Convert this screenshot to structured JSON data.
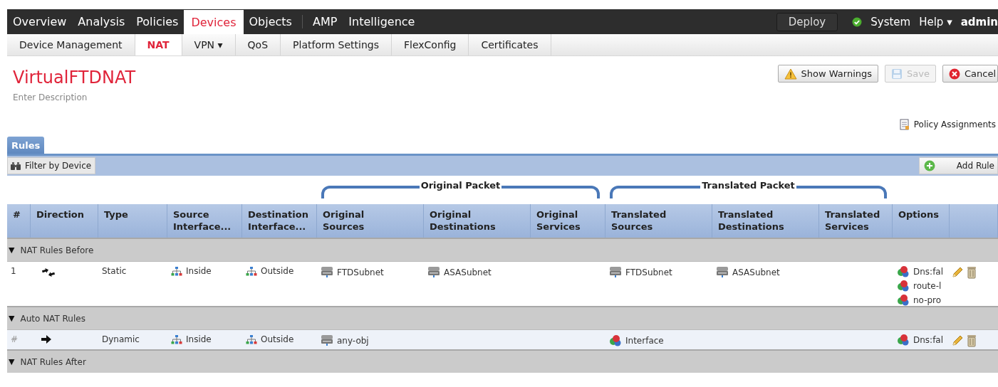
{
  "top_nav": {
    "items": [
      {
        "label": "Overview",
        "selected": false
      },
      {
        "label": "Analysis",
        "selected": false
      },
      {
        "label": "Policies",
        "selected": false
      },
      {
        "label": "Devices",
        "selected": true
      },
      {
        "label": "Objects",
        "selected": false
      },
      {
        "label": "AMP",
        "selected": false
      },
      {
        "label": "Intelligence",
        "selected": false
      }
    ],
    "deploy": "Deploy",
    "status_ok": true,
    "system": "System",
    "help": {
      "label": "Help",
      "caret": "▾"
    },
    "user": "admin"
  },
  "sub_nav": [
    {
      "label": "Device Management",
      "selected": false
    },
    {
      "label": "NAT",
      "selected": true
    },
    {
      "label": "VPN",
      "selected": false,
      "caret": "▾"
    },
    {
      "label": "QoS",
      "selected": false
    },
    {
      "label": "Platform Settings",
      "selected": false
    },
    {
      "label": "FlexConfig",
      "selected": false
    },
    {
      "label": "Certificates",
      "selected": false
    }
  ],
  "policy": {
    "title": "VirtualFTDNAT",
    "description": "Enter Description"
  },
  "buttons": [
    {
      "kind": "warning",
      "label": "Show Warnings",
      "disabled": false
    },
    {
      "kind": "save",
      "label": "Save",
      "disabled": true
    },
    {
      "kind": "cancel",
      "label": "Cancel",
      "disabled": false
    }
  ],
  "policy_assignments": "Policy Assignments",
  "tabs": [
    {
      "label": "Rules",
      "selected": true
    }
  ],
  "toolbar": {
    "filter": "Filter by Device",
    "add": "Add Rule"
  },
  "column_groups": [
    {
      "label": "Original Packet"
    },
    {
      "label": "Translated Packet"
    }
  ],
  "columns": [
    [
      "#"
    ],
    [
      "Direction"
    ],
    [
      "Type"
    ],
    [
      "Source",
      "Interface..."
    ],
    [
      "Destination",
      "Interface..."
    ],
    [
      "Original",
      "Sources"
    ],
    [
      "Original",
      "Destinations"
    ],
    [
      "Original",
      "Services"
    ],
    [
      "Translated",
      "Sources"
    ],
    [
      "Translated",
      "Destinations"
    ],
    [
      "Translated",
      "Services"
    ],
    [
      "Options"
    ]
  ],
  "sections": [
    {
      "label": "NAT Rules Before",
      "caret": "▼",
      "rows": [
        {
          "number": "1",
          "bidirectional": true,
          "type": "Static",
          "source_interface": "Inside",
          "destination_interface": "Outside",
          "original_sources": [
            {
              "kind": "network",
              "label": "FTDSubnet"
            }
          ],
          "original_destinations": [
            {
              "kind": "network",
              "label": "ASASubnet"
            }
          ],
          "translated_sources": [
            {
              "kind": "network",
              "label": "FTDSubnet"
            }
          ],
          "translated_destinations": [
            {
              "kind": "network",
              "label": "ASASubnet"
            }
          ],
          "options": [
            "Dns:fal",
            "route-l",
            "no-pro"
          ]
        }
      ]
    },
    {
      "label": "Auto NAT Rules",
      "caret": "▼",
      "rows": [
        {
          "number": "#",
          "bidirectional": false,
          "type": "Dynamic",
          "source_interface": "Inside",
          "destination_interface": "Outside",
          "original_sources": [
            {
              "kind": "network",
              "label": "any-obj"
            }
          ],
          "translated_sources": [
            {
              "kind": "object",
              "label": "Interface"
            }
          ],
          "options": [
            "Dns:fal"
          ]
        }
      ]
    },
    {
      "label": "NAT Rules After",
      "caret": "▼"
    }
  ]
}
